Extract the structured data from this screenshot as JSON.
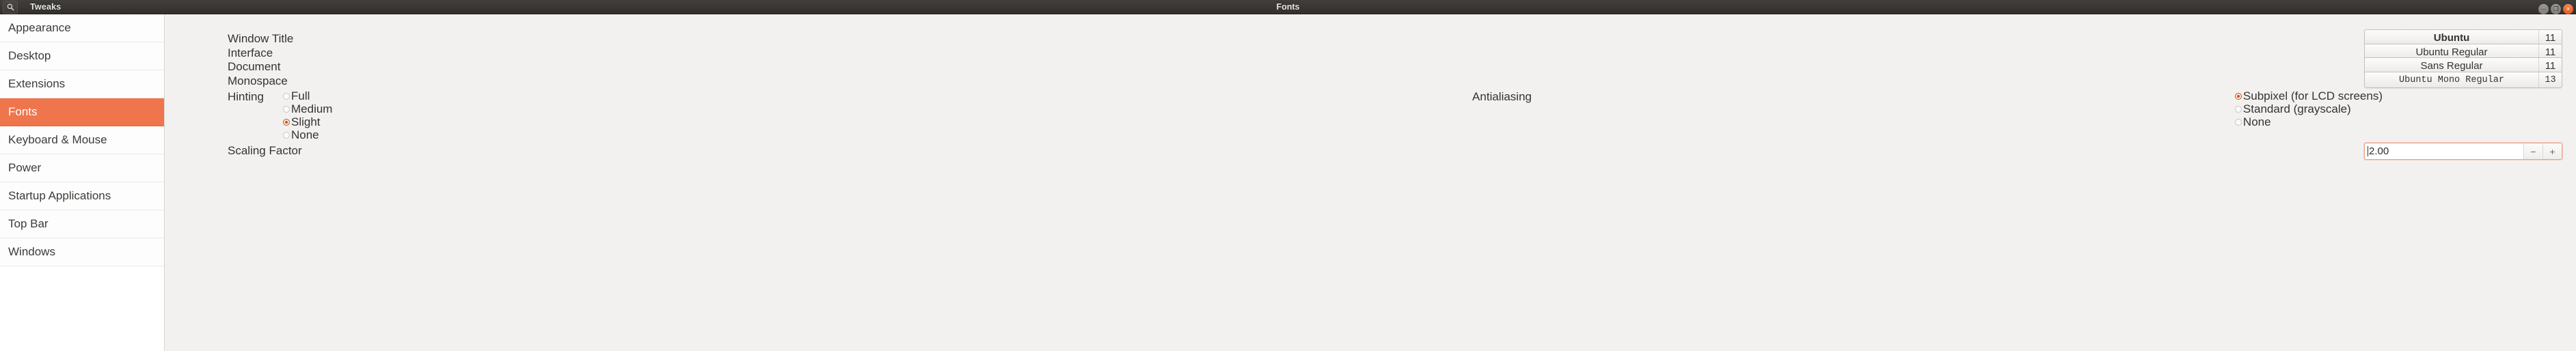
{
  "titlebar": {
    "app_name": "Tweaks",
    "window_title": "Fonts",
    "search_icon": "search-icon",
    "controls": {
      "minimize": "–",
      "maximize": "❐",
      "close": "×"
    }
  },
  "sidebar": {
    "items": [
      {
        "label": "Appearance",
        "selected": false
      },
      {
        "label": "Desktop",
        "selected": false
      },
      {
        "label": "Extensions",
        "selected": false
      },
      {
        "label": "Fonts",
        "selected": true
      },
      {
        "label": "Keyboard & Mouse",
        "selected": false
      },
      {
        "label": "Power",
        "selected": false
      },
      {
        "label": "Startup Applications",
        "selected": false
      },
      {
        "label": "Top Bar",
        "selected": false
      },
      {
        "label": "Windows",
        "selected": false
      }
    ]
  },
  "main": {
    "font_rows": [
      {
        "label": "Window Title",
        "font_name": "Ubuntu",
        "font_size": "11"
      },
      {
        "label": "Interface",
        "font_name": "Ubuntu Regular",
        "font_size": "11"
      },
      {
        "label": "Document",
        "font_name": "Sans Regular",
        "font_size": "11"
      },
      {
        "label": "Monospace",
        "font_name": "Ubuntu Mono Regular",
        "font_size": "13"
      }
    ],
    "hinting": {
      "label": "Hinting",
      "options": [
        {
          "label": "Full",
          "checked": false
        },
        {
          "label": "Medium",
          "checked": false
        },
        {
          "label": "Slight",
          "checked": true
        },
        {
          "label": "None",
          "checked": false
        }
      ]
    },
    "antialiasing": {
      "label": "Antialiasing",
      "options": [
        {
          "label": "Subpixel (for LCD screens)",
          "checked": true
        },
        {
          "label": "Standard (grayscale)",
          "checked": false
        },
        {
          "label": "None",
          "checked": false
        }
      ]
    },
    "scaling_factor": {
      "label": "Scaling Factor",
      "value": "2.00",
      "decrement": "−",
      "increment": "+"
    }
  },
  "colors": {
    "accent": "#ef754d",
    "selection_text": "#ffffff",
    "titlebar": "#3a3734",
    "content_bg": "#f2f1f0",
    "radio_active": "#d0501a"
  }
}
